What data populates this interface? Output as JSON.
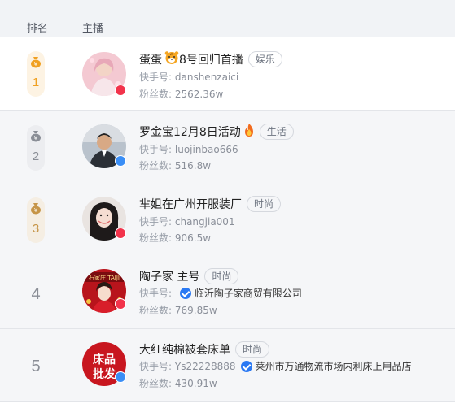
{
  "header": {
    "rank": "排名",
    "anchor": "主播"
  },
  "labels": {
    "kuaishou": "快手号:",
    "fans": "粉丝数:"
  },
  "rows": [
    {
      "rank": "1",
      "name": "蛋蛋",
      "name_suffix": "8号回归首播",
      "tag": "娱乐",
      "kuaishou_id": "danshenzaici",
      "fans": "2562.36w",
      "gender": "female",
      "emoji": "tiger-emoji-icon"
    },
    {
      "rank": "2",
      "name": "罗金宝12月8日活动",
      "tag": "生活",
      "kuaishou_id": "luojinbao666",
      "fans": "516.8w",
      "gender": "male",
      "emoji": "fire-emoji-icon"
    },
    {
      "rank": "3",
      "name": "芈姐在广州开服装厂",
      "tag": "时尚",
      "kuaishou_id": "changjia001",
      "fans": "906.5w",
      "gender": "female"
    },
    {
      "rank": "4",
      "name": "陶子家 主号",
      "tag": "时尚",
      "kuaishou_id": "",
      "company": "临沂陶子家商贸有限公司",
      "fans": "769.85w",
      "gender": "female",
      "avatar_text": "石家庄  TAIJI"
    },
    {
      "rank": "5",
      "name": "大红纯棉被套床单",
      "tag": "时尚",
      "kuaishou_id": "Ys22228888",
      "company": "莱州市万通物流市场内利床上用品店",
      "fans": "430.91w",
      "gender": "male",
      "avatar_text_top": "床品",
      "avatar_text_bottom": "批发"
    }
  ],
  "colors": {
    "gold": "#f0a021",
    "silver": "#8a8e96",
    "bronze": "#c69548",
    "verify": "#2a79f3",
    "female": "#f2334b",
    "male": "#3a8ef6"
  }
}
